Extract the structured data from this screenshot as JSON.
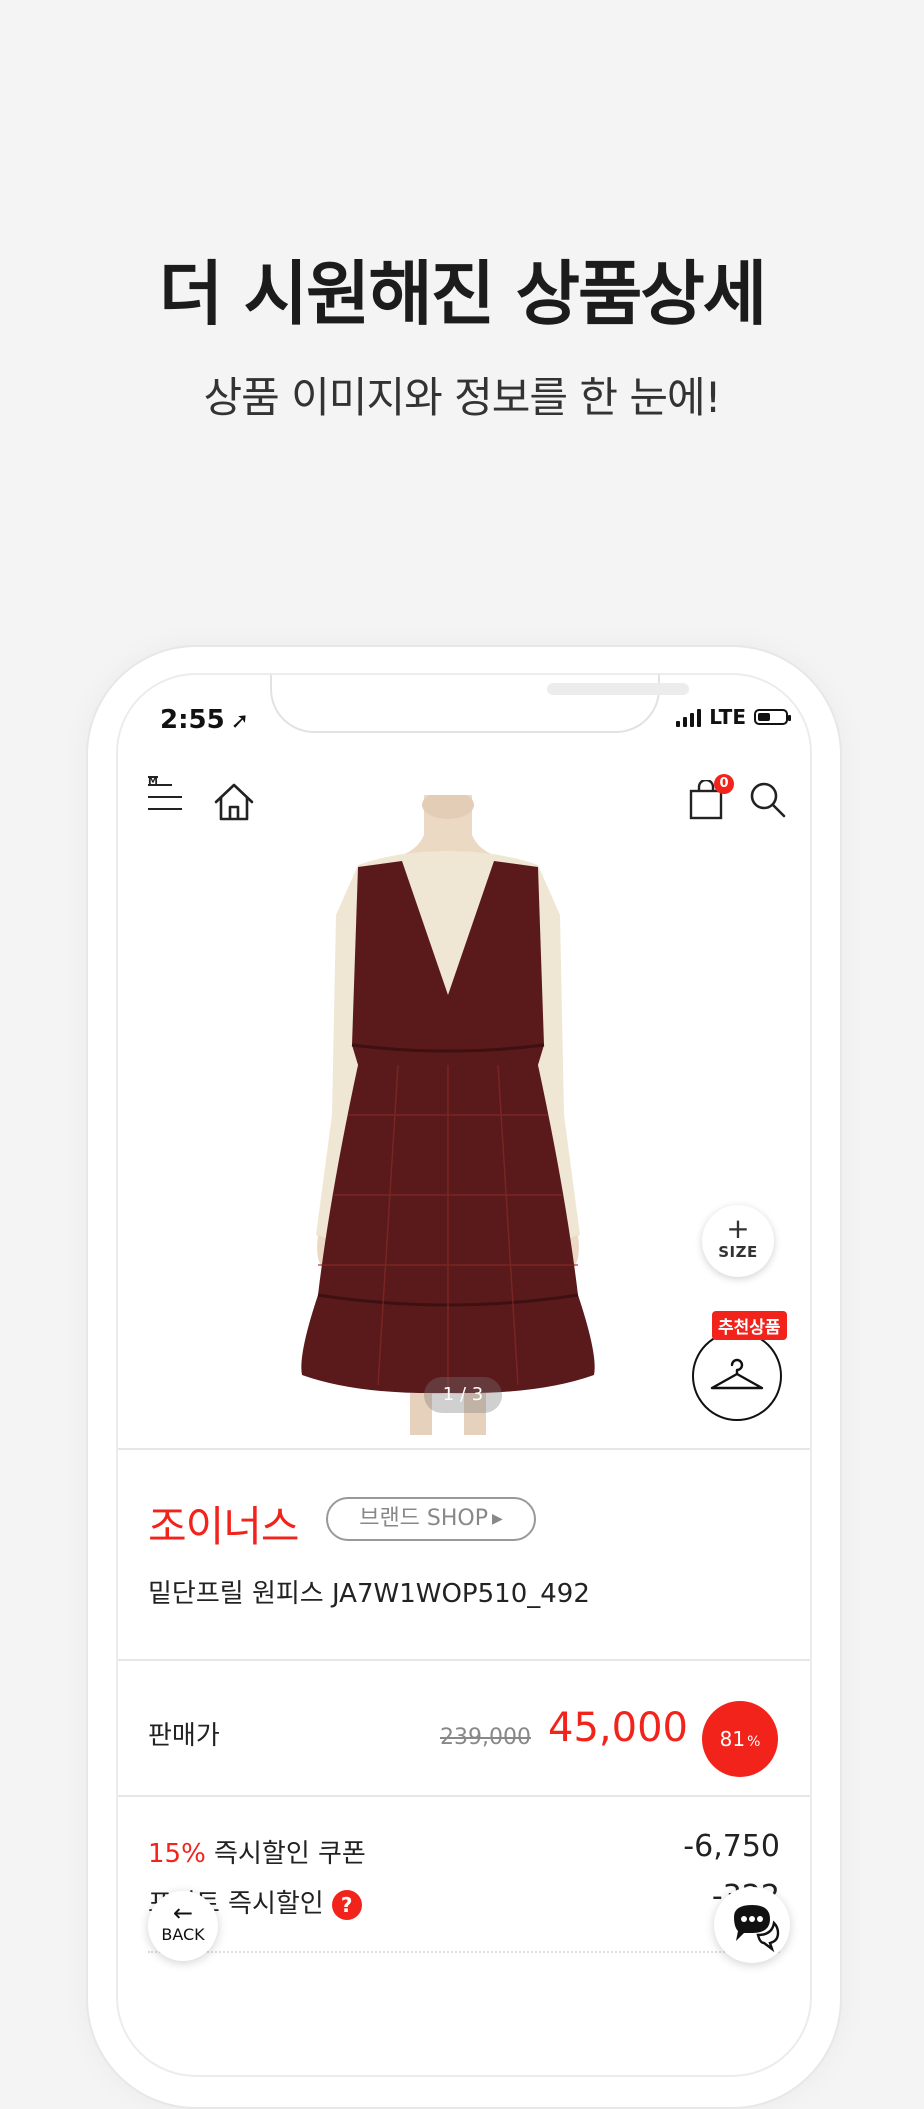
{
  "promo": {
    "headline": "더 시원해진 상품상세",
    "subline": "상품 이미지와 정보를 한 눈에!"
  },
  "status_bar": {
    "time": "2:55",
    "network": "LTE"
  },
  "header": {
    "cart_count": "0",
    "menu_mark": "M"
  },
  "gallery": {
    "page_indicator": "1 / 3",
    "size_button_label": "SIZE",
    "recommend_tag": "추천상품"
  },
  "brand": {
    "name": "조이너스",
    "shop_button": "브랜드 SHOP"
  },
  "product": {
    "name": "밑단프릴 원피스 JA7W1WOP510_492"
  },
  "price": {
    "label": "판매가",
    "original": "239,000",
    "sale": "45,000",
    "discount_rate": "81",
    "discount_unit": "%"
  },
  "discounts": {
    "coupon_percent": "15%",
    "coupon_label": " 즉시할인 쿠폰",
    "coupon_value": "-6,750",
    "point_label": "포인트 즉시할인",
    "point_help": "?",
    "point_value": "-322"
  },
  "floating": {
    "back_label": "BACK"
  },
  "colors": {
    "accent": "#f2231b",
    "dress": "#5a1a1c",
    "sweater": "#efe6d4"
  }
}
